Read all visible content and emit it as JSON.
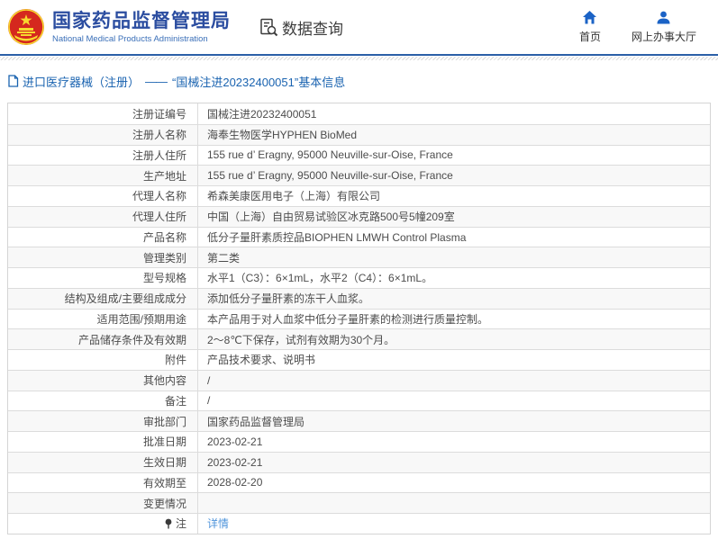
{
  "header": {
    "org_name_cn": "国家药品监督管理局",
    "org_name_en": "National Medical Products Administration",
    "data_query_label": "数据查询",
    "nav_home": "首页",
    "nav_service_hall": "网上办事大厅"
  },
  "breadcrumb": {
    "category": "进口医疗器械（注册）",
    "dash": "——",
    "title": "“国械注进20232400051”基本信息"
  },
  "table": {
    "rows": [
      {
        "label": "注册证编号",
        "value": "国械注进20232400051"
      },
      {
        "label": "注册人名称",
        "value": "海奉生物医学HYPHEN BioMed"
      },
      {
        "label": "注册人住所",
        "value": "155 rue d’ Eragny, 95000 Neuville-sur-Oise, France"
      },
      {
        "label": "生产地址",
        "value": "155 rue d’ Eragny, 95000 Neuville-sur-Oise, France"
      },
      {
        "label": "代理人名称",
        "value": "希森美康医用电子（上海）有限公司"
      },
      {
        "label": "代理人住所",
        "value": "中国（上海）自由贸易试验区冰克路500号5幢209室"
      },
      {
        "label": "产品名称",
        "value": "低分子量肝素质控品BIOPHEN LMWH Control Plasma"
      },
      {
        "label": "管理类别",
        "value": "第二类"
      },
      {
        "label": "型号规格",
        "value": "水平1（C3）：6×1mL，水平2（C4）：6×1mL。"
      },
      {
        "label": "结构及组成/主要组成成分",
        "value": "添加低分子量肝素的冻干人血浆。"
      },
      {
        "label": "适用范围/预期用途",
        "value": "本产品用于对人血浆中低分子量肝素的检测进行质量控制。"
      },
      {
        "label": "产品储存条件及有效期",
        "value": "2～8℃下保存，试剂有效期为30个月。"
      },
      {
        "label": "附件",
        "value": "产品技术要求、说明书"
      },
      {
        "label": "其他内容",
        "value": "/"
      },
      {
        "label": "备注",
        "value": "/"
      },
      {
        "label": "审批部门",
        "value": "国家药品监督管理局"
      },
      {
        "label": "批准日期",
        "value": "2023-02-21"
      },
      {
        "label": "生效日期",
        "value": "2023-02-21"
      },
      {
        "label": "有效期至",
        "value": "2028-02-20"
      },
      {
        "label": "变更情况",
        "value": ""
      },
      {
        "label": "注",
        "label_icon": "note-icon",
        "value": "详情",
        "type": "link"
      }
    ]
  },
  "theme": {
    "title_blue": "#2b4da0",
    "subtitle_blue": "#3a6fb8",
    "divider_blue": "#2b5fa7",
    "breadcrumb_blue": "#1a63b0",
    "icon_blue": "#1b63c6",
    "link_blue": "#4f94db",
    "border_gray": "#d5d5d5",
    "row_stripe": "#f8f8f8",
    "text_gray": "#4c4c4c",
    "emblem_red": "#d5281e",
    "emblem_gold": "#f7d92e"
  }
}
